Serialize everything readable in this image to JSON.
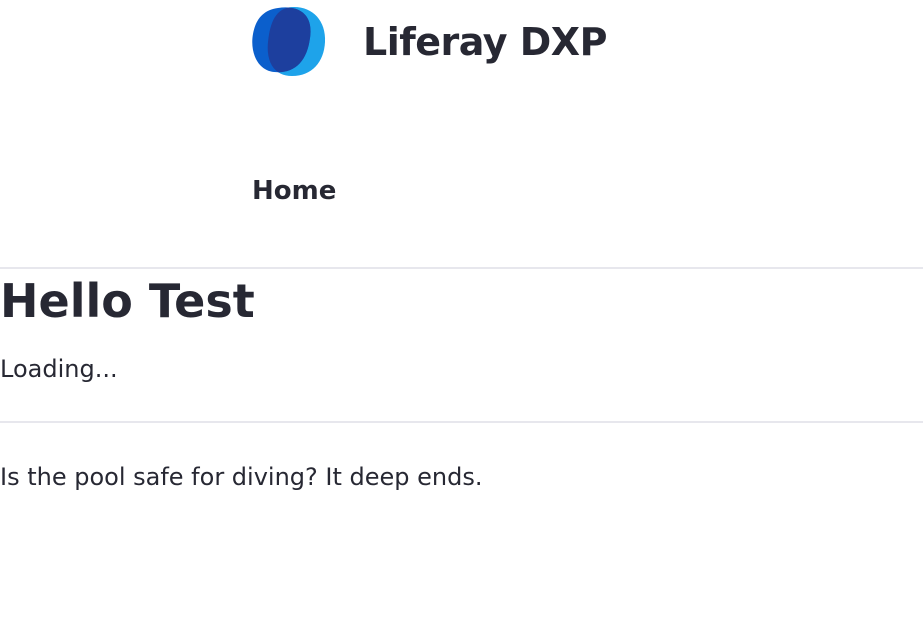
{
  "header": {
    "site_name": "Liferay DXP",
    "logo_icon": "liferay-logo-icon",
    "logo_colors": {
      "back": "#1ea3ea",
      "front": "#0b5fcc",
      "overlap": "#1d3f9e"
    }
  },
  "nav": {
    "items": [
      {
        "label": "Home"
      }
    ]
  },
  "main": {
    "title": "Hello Test",
    "status_text": "Loading...",
    "body_text": "Is the pool safe for diving? It deep ends."
  },
  "theme": {
    "text_color": "#272833",
    "divider_color": "#e7e7ed",
    "background": "#ffffff"
  }
}
